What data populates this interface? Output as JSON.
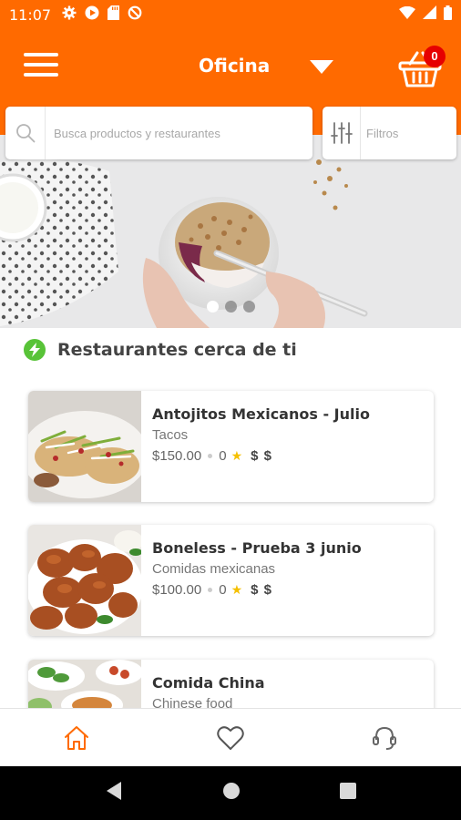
{
  "status_bar": {
    "time": "11:07",
    "left_icons": [
      "settings-icon",
      "play-icon",
      "sd-card-icon",
      "no-sign-icon"
    ],
    "right_icons": [
      "wifi-icon",
      "signal-icon",
      "battery-icon"
    ]
  },
  "header": {
    "location": "Oficina",
    "cart_count": "0"
  },
  "search": {
    "placeholder": "Busca productos y restaurantes",
    "filter_label": "Filtros"
  },
  "banner": {
    "slides": 3,
    "active_slide": 1
  },
  "section": {
    "title": "Restaurantes cerca de ti"
  },
  "restaurants": [
    {
      "name": "Antojitos Mexicanos - Julio",
      "category": "Tacos",
      "min_price": "$150.00",
      "rating": "0",
      "price_level": "$ $"
    },
    {
      "name": "Boneless - Prueba 3 junio",
      "category": "Comidas mexicanas",
      "min_price": "$100.00",
      "rating": "0",
      "price_level": "$ $"
    },
    {
      "name": "Comida China",
      "category": "Chinese food",
      "min_price": "",
      "rating": "",
      "price_level": ""
    }
  ],
  "bottom_nav": {
    "tabs": [
      "home-icon",
      "heart-icon",
      "support-icon"
    ],
    "active": "home-icon"
  },
  "colors": {
    "brand": "#ff6a00",
    "badge": "#e60000",
    "bolt": "#58c338",
    "star": "#f5c000"
  }
}
